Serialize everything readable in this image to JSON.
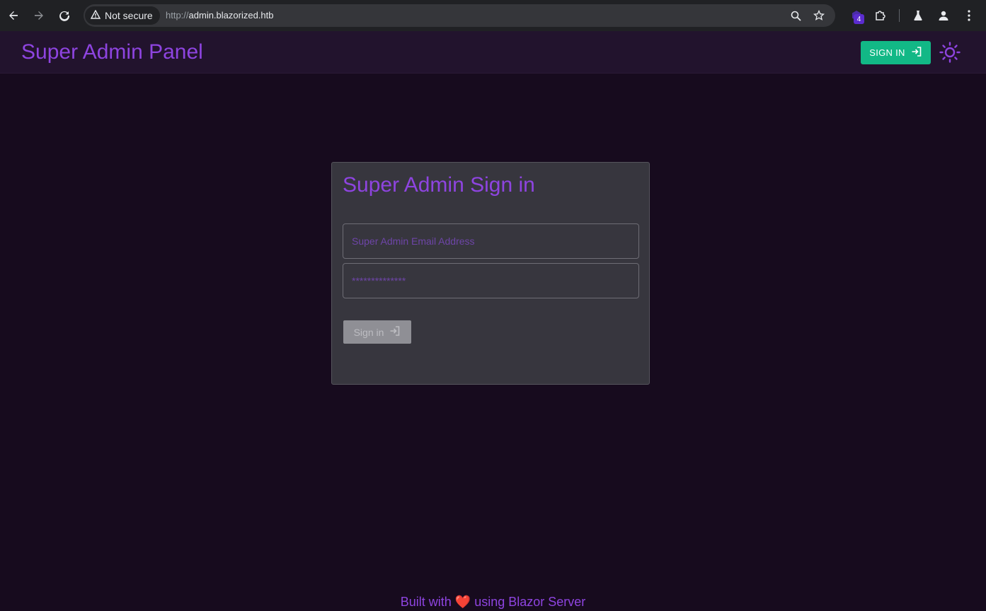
{
  "browser": {
    "security_label": "Not secure",
    "url_scheme": "http://",
    "url_host": "admin.blazorized.htb",
    "extension_badge": "4"
  },
  "appbar": {
    "title": "Super Admin Panel",
    "signin_label": "SIGN IN",
    "accent_color": "#8e44e0",
    "button_color": "#12b886"
  },
  "login": {
    "title": "Super Admin Sign in",
    "email_placeholder": "Super Admin Email Address",
    "password_placeholder": "**************",
    "submit_label": "Sign in"
  },
  "footer": {
    "prefix": "Built with",
    "heart": "❤️",
    "suffix": "using Blazor Server"
  }
}
